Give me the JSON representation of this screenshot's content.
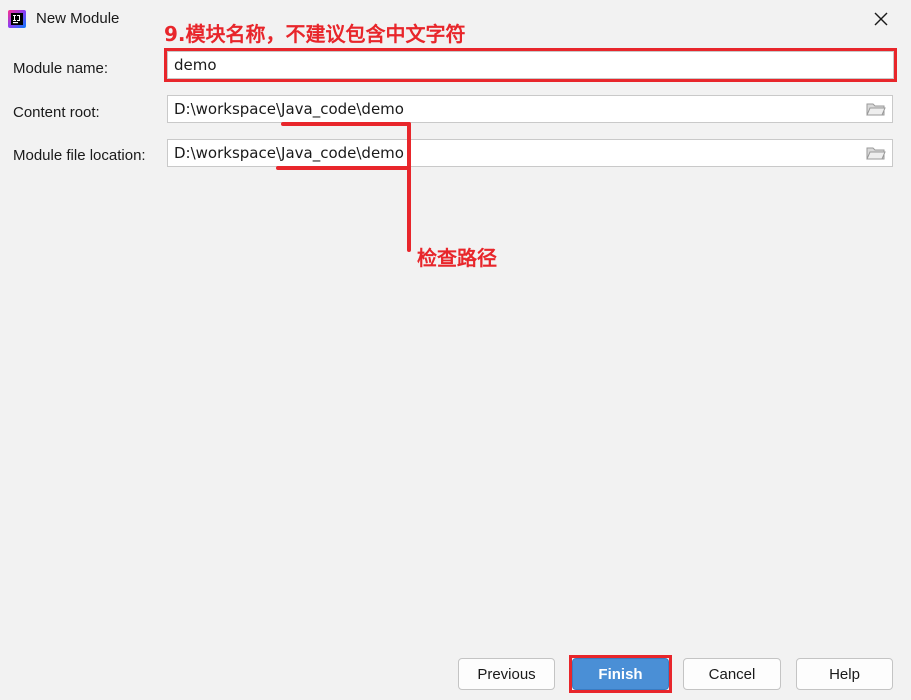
{
  "window": {
    "title": "New Module",
    "icon": "intellij-idea-icon",
    "close_icon": "close-icon"
  },
  "annotations": {
    "module_name_note": "9.模块名称，不建议包含中文字符",
    "path_note": "检查路径",
    "highlight_color": "#e8262b"
  },
  "form": {
    "module_name": {
      "label": "Module name:",
      "value": "demo"
    },
    "content_root": {
      "label": "Content root:",
      "value": "D:\\workspace\\Java_code\\demo",
      "browse_icon": "folder-icon"
    },
    "module_file_location": {
      "label": "Module file location:",
      "value": "D:\\workspace\\Java_code\\demo",
      "browse_icon": "folder-icon"
    }
  },
  "buttons": {
    "previous": "Previous",
    "finish": "Finish",
    "cancel": "Cancel",
    "help": "Help"
  }
}
